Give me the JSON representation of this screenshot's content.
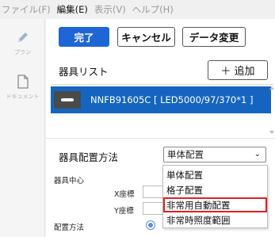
{
  "menu": {
    "file": "ファイル(F)",
    "edit": "編集(E)",
    "view": "表示(V)",
    "help": "ヘルプ(H)"
  },
  "rail": {
    "plan_label": "プラン",
    "document_label": "ドキュメント"
  },
  "toolbar": {
    "done_label": "完了",
    "cancel_label": "キャンセル",
    "data_change_label": "データ変更"
  },
  "fixture_list": {
    "title": "器具リスト",
    "add_label": "＋ 追加",
    "items": [
      {
        "label": "NNFB91605C [ LED5000/97/370*1 ]"
      }
    ]
  },
  "placement": {
    "title": "器具配置方法",
    "selected": "単体配置",
    "options": [
      "単体配置",
      "格子配置",
      "非常用自動配置",
      "非常時照度範囲"
    ],
    "highlighted_option": "非常用自動配置"
  },
  "fixture_center": {
    "label": "器具中心",
    "x_label": "X座標",
    "y_label": "Y座標"
  },
  "placement_method_label": "配置方法",
  "colors": {
    "primary": "#1e65d6",
    "selected_row": "#1565c0",
    "highlight_box": "#e02020"
  }
}
